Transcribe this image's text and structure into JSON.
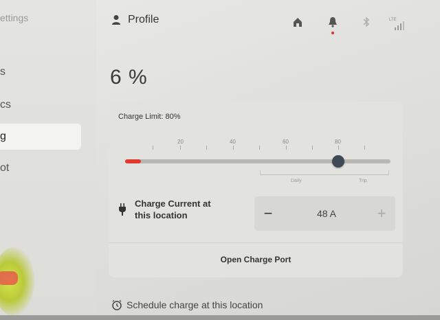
{
  "sidebar": {
    "title": "ettings",
    "items": [
      {
        "label": "s"
      },
      {
        "label": "cs"
      },
      {
        "label": "g"
      },
      {
        "label": "ot"
      }
    ],
    "active_index": 2
  },
  "header": {
    "profile_label": "Profile",
    "signal_label": "LTE"
  },
  "main": {
    "battery_percent": "6 %",
    "charge_limit_label": "Charge Limit: 80%",
    "charge_limit_value": 80,
    "battery_fill_fraction": 0.06,
    "scale_labels": [
      "20",
      "40",
      "60",
      "80"
    ],
    "daily_label": "Daily",
    "trip_label": "Trip",
    "charge_current_label_line1": "Charge Current at",
    "charge_current_label_line2": "this location",
    "charge_current_value": "48 A",
    "decrease_symbol": "−",
    "increase_symbol": "+",
    "open_charge_port_label": "Open Charge Port",
    "schedule_label": "Schedule charge at this location"
  },
  "colors": {
    "accent_red": "#e33a2e",
    "knob": "#3f4a56"
  }
}
